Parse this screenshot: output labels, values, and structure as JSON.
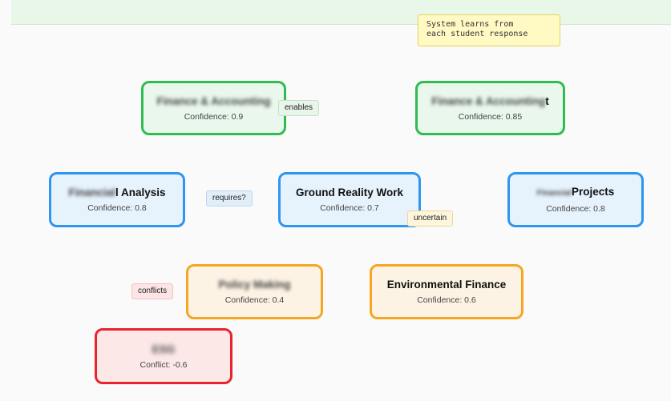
{
  "note": {
    "line1": "System learns from",
    "line2": "each student response"
  },
  "nodes": {
    "finance_accounting": {
      "label": "Finance & Accounting",
      "confidence": "Confidence: 0.9",
      "color": "#2ebd4f"
    },
    "finance_accounting_t": {
      "label": "Finance & Accounting",
      "label_suffix": "t",
      "confidence": "Confidence: 0.85",
      "color": "#2ebd4f"
    },
    "analysis": {
      "label_hidden": "Financial",
      "label": "l Analysis",
      "confidence": "Confidence: 0.8",
      "color": "#2c96f0"
    },
    "ground_reality": {
      "label": "Ground Reality Work",
      "confidence": "Confidence: 0.7",
      "color": "#2c96f0"
    },
    "projects": {
      "label_hidden": "Financial",
      "label": "Projects",
      "confidence": "Confidence: 0.8",
      "color": "#2c96f0"
    },
    "policy_making": {
      "label": "Policy Making",
      "confidence": "Confidence: 0.4",
      "color": "#f5a623"
    },
    "environmental_finance": {
      "label": "Environmental Finance",
      "confidence": "Confidence: 0.6",
      "color": "#f5a623"
    },
    "conflict_node": {
      "label": "ESG",
      "confidence": "Conflict: -0.6",
      "color": "#e8242e"
    }
  },
  "edge_labels": {
    "enables": "enables",
    "requires": "requires?",
    "uncertain": "uncertain",
    "conflicts": "conflicts"
  }
}
